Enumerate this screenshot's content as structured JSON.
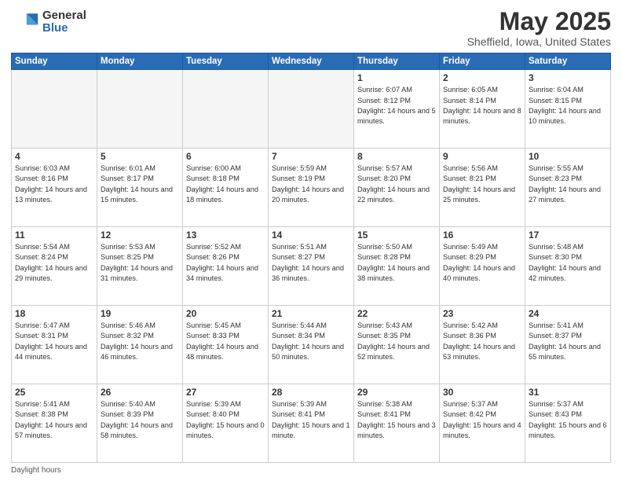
{
  "logo": {
    "general": "General",
    "blue": "Blue"
  },
  "title": {
    "month_year": "May 2025",
    "location": "Sheffield, Iowa, United States"
  },
  "days_of_week": [
    "Sunday",
    "Monday",
    "Tuesday",
    "Wednesday",
    "Thursday",
    "Friday",
    "Saturday"
  ],
  "weeks": [
    [
      {
        "day": "",
        "info": ""
      },
      {
        "day": "",
        "info": ""
      },
      {
        "day": "",
        "info": ""
      },
      {
        "day": "",
        "info": ""
      },
      {
        "day": "1",
        "info": "Sunrise: 6:07 AM\nSunset: 8:12 PM\nDaylight: 14 hours\nand 5 minutes."
      },
      {
        "day": "2",
        "info": "Sunrise: 6:05 AM\nSunset: 8:14 PM\nDaylight: 14 hours\nand 8 minutes."
      },
      {
        "day": "3",
        "info": "Sunrise: 6:04 AM\nSunset: 8:15 PM\nDaylight: 14 hours\nand 10 minutes."
      }
    ],
    [
      {
        "day": "4",
        "info": "Sunrise: 6:03 AM\nSunset: 8:16 PM\nDaylight: 14 hours\nand 13 minutes."
      },
      {
        "day": "5",
        "info": "Sunrise: 6:01 AM\nSunset: 8:17 PM\nDaylight: 14 hours\nand 15 minutes."
      },
      {
        "day": "6",
        "info": "Sunrise: 6:00 AM\nSunset: 8:18 PM\nDaylight: 14 hours\nand 18 minutes."
      },
      {
        "day": "7",
        "info": "Sunrise: 5:59 AM\nSunset: 8:19 PM\nDaylight: 14 hours\nand 20 minutes."
      },
      {
        "day": "8",
        "info": "Sunrise: 5:57 AM\nSunset: 8:20 PM\nDaylight: 14 hours\nand 22 minutes."
      },
      {
        "day": "9",
        "info": "Sunrise: 5:56 AM\nSunset: 8:21 PM\nDaylight: 14 hours\nand 25 minutes."
      },
      {
        "day": "10",
        "info": "Sunrise: 5:55 AM\nSunset: 8:23 PM\nDaylight: 14 hours\nand 27 minutes."
      }
    ],
    [
      {
        "day": "11",
        "info": "Sunrise: 5:54 AM\nSunset: 8:24 PM\nDaylight: 14 hours\nand 29 minutes."
      },
      {
        "day": "12",
        "info": "Sunrise: 5:53 AM\nSunset: 8:25 PM\nDaylight: 14 hours\nand 31 minutes."
      },
      {
        "day": "13",
        "info": "Sunrise: 5:52 AM\nSunset: 8:26 PM\nDaylight: 14 hours\nand 34 minutes."
      },
      {
        "day": "14",
        "info": "Sunrise: 5:51 AM\nSunset: 8:27 PM\nDaylight: 14 hours\nand 36 minutes."
      },
      {
        "day": "15",
        "info": "Sunrise: 5:50 AM\nSunset: 8:28 PM\nDaylight: 14 hours\nand 38 minutes."
      },
      {
        "day": "16",
        "info": "Sunrise: 5:49 AM\nSunset: 8:29 PM\nDaylight: 14 hours\nand 40 minutes."
      },
      {
        "day": "17",
        "info": "Sunrise: 5:48 AM\nSunset: 8:30 PM\nDaylight: 14 hours\nand 42 minutes."
      }
    ],
    [
      {
        "day": "18",
        "info": "Sunrise: 5:47 AM\nSunset: 8:31 PM\nDaylight: 14 hours\nand 44 minutes."
      },
      {
        "day": "19",
        "info": "Sunrise: 5:46 AM\nSunset: 8:32 PM\nDaylight: 14 hours\nand 46 minutes."
      },
      {
        "day": "20",
        "info": "Sunrise: 5:45 AM\nSunset: 8:33 PM\nDaylight: 14 hours\nand 48 minutes."
      },
      {
        "day": "21",
        "info": "Sunrise: 5:44 AM\nSunset: 8:34 PM\nDaylight: 14 hours\nand 50 minutes."
      },
      {
        "day": "22",
        "info": "Sunrise: 5:43 AM\nSunset: 8:35 PM\nDaylight: 14 hours\nand 52 minutes."
      },
      {
        "day": "23",
        "info": "Sunrise: 5:42 AM\nSunset: 8:36 PM\nDaylight: 14 hours\nand 53 minutes."
      },
      {
        "day": "24",
        "info": "Sunrise: 5:41 AM\nSunset: 8:37 PM\nDaylight: 14 hours\nand 55 minutes."
      }
    ],
    [
      {
        "day": "25",
        "info": "Sunrise: 5:41 AM\nSunset: 8:38 PM\nDaylight: 14 hours\nand 57 minutes."
      },
      {
        "day": "26",
        "info": "Sunrise: 5:40 AM\nSunset: 8:39 PM\nDaylight: 14 hours\nand 58 minutes."
      },
      {
        "day": "27",
        "info": "Sunrise: 5:39 AM\nSunset: 8:40 PM\nDaylight: 15 hours\nand 0 minutes."
      },
      {
        "day": "28",
        "info": "Sunrise: 5:39 AM\nSunset: 8:41 PM\nDaylight: 15 hours\nand 1 minute."
      },
      {
        "day": "29",
        "info": "Sunrise: 5:38 AM\nSunset: 8:41 PM\nDaylight: 15 hours\nand 3 minutes."
      },
      {
        "day": "30",
        "info": "Sunrise: 5:37 AM\nSunset: 8:42 PM\nDaylight: 15 hours\nand 4 minutes."
      },
      {
        "day": "31",
        "info": "Sunrise: 5:37 AM\nSunset: 8:43 PM\nDaylight: 15 hours\nand 6 minutes."
      }
    ]
  ],
  "footer": {
    "note": "Daylight hours"
  }
}
